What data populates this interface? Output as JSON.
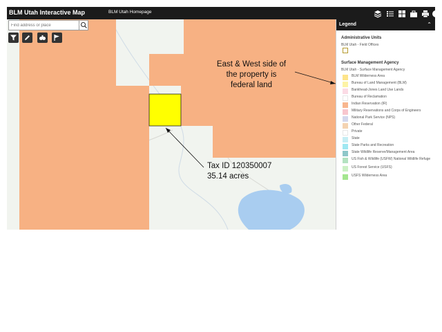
{
  "header": {
    "app_title": "BLM Utah Interactive Map",
    "home_link": "BLM Utah Homepage",
    "tools": [
      "layers-icon",
      "list-icon",
      "grid-icon",
      "briefcase-icon",
      "print-icon",
      "info-icon"
    ]
  },
  "search": {
    "placeholder": "Find address or place"
  },
  "map_tools": [
    "filter-icon",
    "pencil-icon",
    "binoculars-icon",
    "flag-icon"
  ],
  "annotations": {
    "federal_note": [
      "East & West side of",
      "the property is",
      "federal land"
    ],
    "tax_note": [
      "Tax ID 120350007",
      "35.14 acres"
    ]
  },
  "colors": {
    "federal_land": "#f7b183",
    "parcel": "#ffff00",
    "map_background": "#f1f4ef",
    "water": "#a9cdf0",
    "header": "#1b1b1b"
  },
  "legend": {
    "title": "Legend",
    "admin_units": {
      "title": "Administrative Units",
      "layer": "BLM Utah - Field Offices"
    },
    "surface_mgmt": {
      "title": "Surface Management Agency",
      "layer": "BLM Utah - Surface Management Agency",
      "items": [
        {
          "label": "BLM Wilderness Area",
          "color": "#fde48a"
        },
        {
          "label": "Bureau of Land Management (BLM)",
          "color": "#fdf3a5"
        },
        {
          "label": "Bankhead-Jones Land Use Lands",
          "color": "#fbdbe5"
        },
        {
          "label": "Bureau of Reclamation",
          "color": "#ffffff"
        },
        {
          "label": "Indian Reservation (IR)",
          "color": "#f8b68e"
        },
        {
          "label": "Military Reservations and Corps of Engineers",
          "color": "#f8c6ce"
        },
        {
          "label": "National Park Service (NPS)",
          "color": "#d3d7ed"
        },
        {
          "label": "Other Federal",
          "color": "#f4d3b2"
        },
        {
          "label": "Private",
          "color": "#ffffff"
        },
        {
          "label": "State",
          "color": "#c5eef4"
        },
        {
          "label": "State Parks and Recreation",
          "color": "#9fe8f2"
        },
        {
          "label": "State Wildlife Reserve/Management Area",
          "color": "#8fc7c9"
        },
        {
          "label": "US Fish & Wildlife (USFW) National Wildlife Refuge",
          "color": "#b4e2c1"
        },
        {
          "label": "US Forest Service (USFS)",
          "color": "#ccf0c5"
        },
        {
          "label": "USFS Wilderness Area",
          "color": "#a4e68f"
        }
      ]
    }
  }
}
